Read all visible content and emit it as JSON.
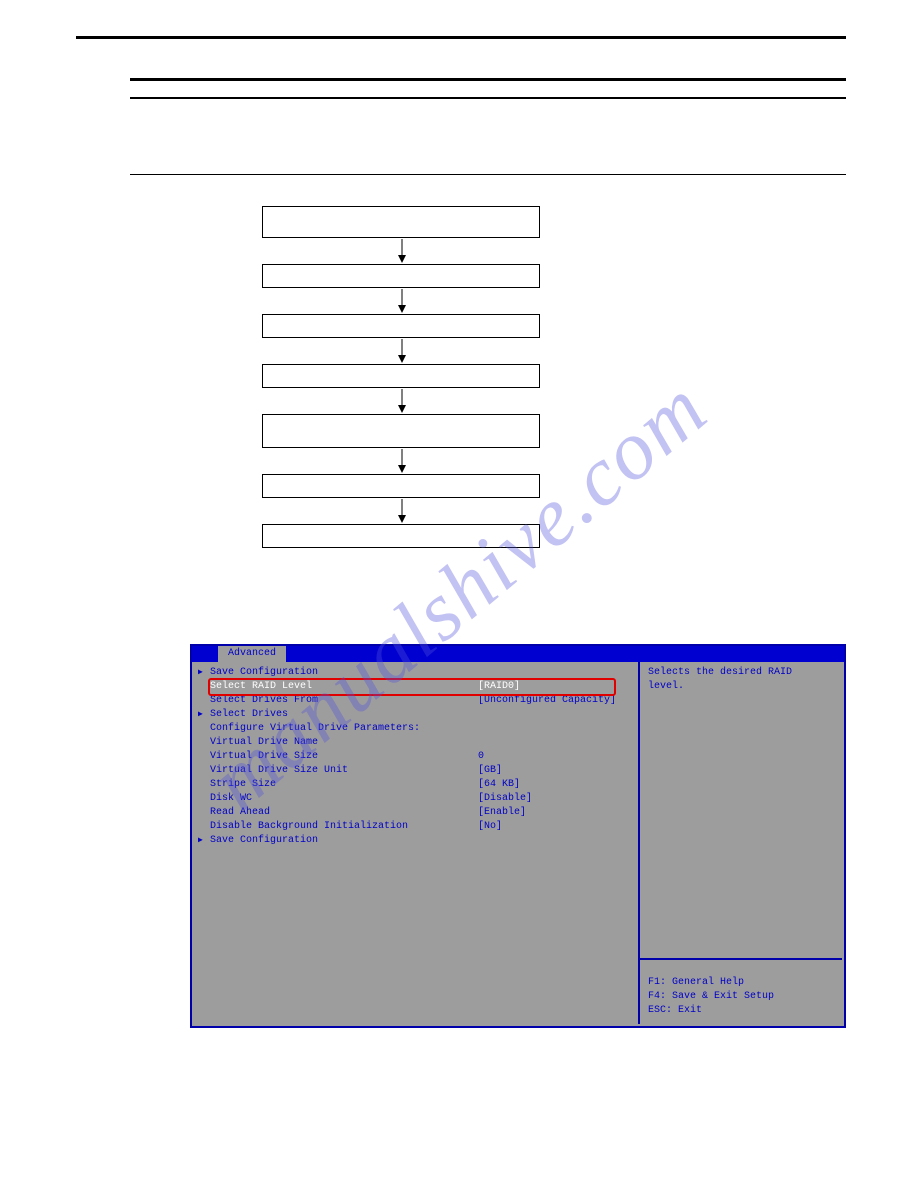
{
  "bios": {
    "tab": "Advanced",
    "rows": [
      {
        "arrow": true,
        "label": "Save Configuration",
        "value": ""
      },
      {
        "arrow": false,
        "label": "Select RAID Level",
        "value": "[RAID0]",
        "highlight": true
      },
      {
        "arrow": false,
        "label": "Select Drives From",
        "value": "[Unconfigured Capacity]"
      },
      {
        "arrow": true,
        "label": "Select Drives",
        "value": ""
      },
      {
        "arrow": false,
        "label": "Configure Virtual Drive Parameters:",
        "value": ""
      },
      {
        "arrow": false,
        "label": "Virtual Drive Name",
        "value": ""
      },
      {
        "arrow": false,
        "label": "Virtual Drive Size",
        "value": "0"
      },
      {
        "arrow": false,
        "label": "Virtual Drive Size Unit",
        "value": "[GB]"
      },
      {
        "arrow": false,
        "label": "Stripe Size",
        "value": "[64 KB]"
      },
      {
        "arrow": false,
        "label": "Disk WC",
        "value": "[Disable]"
      },
      {
        "arrow": false,
        "label": "Read Ahead",
        "value": "[Enable]"
      },
      {
        "arrow": false,
        "label": "Disable Background Initialization",
        "value": "[No]"
      },
      {
        "arrow": true,
        "label": "Save Configuration",
        "value": ""
      }
    ],
    "help_top": "Selects the desired RAID\nlevel.",
    "help_bottom": "F1: General Help\nF4: Save & Exit Setup\nESC: Exit"
  },
  "flow_boxes": [
    "",
    "",
    "",
    "",
    "",
    "",
    ""
  ],
  "watermark": "manualshive.com"
}
